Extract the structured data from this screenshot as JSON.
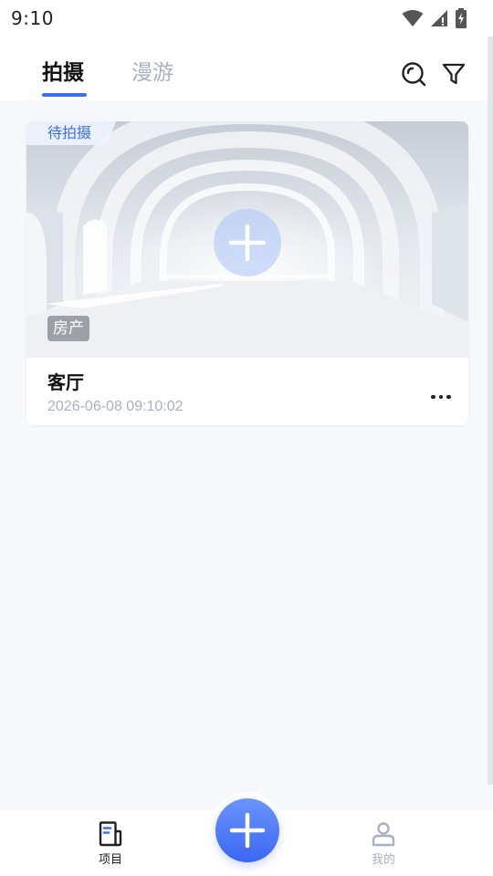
{
  "status_bar": {
    "time": "9:10",
    "icons": [
      "wifi-icon",
      "signal-icon",
      "battery-charging-icon"
    ]
  },
  "header": {
    "tabs": [
      {
        "label": "拍摄",
        "active": true
      },
      {
        "label": "漫游",
        "active": false
      }
    ],
    "actions": [
      "search-icon",
      "filter-icon"
    ],
    "accent_color": "#3a6ff6"
  },
  "projects": [
    {
      "status": "待拍摄",
      "category": "房产",
      "title": "客厅",
      "date": "2026-06-08 09:10:02"
    }
  ],
  "bottom_nav": {
    "items": [
      {
        "label": "项目",
        "icon": "document-icon",
        "active": true
      },
      {
        "label": "我的",
        "icon": "person-icon",
        "active": false
      }
    ],
    "fab_icon": "plus-icon"
  }
}
